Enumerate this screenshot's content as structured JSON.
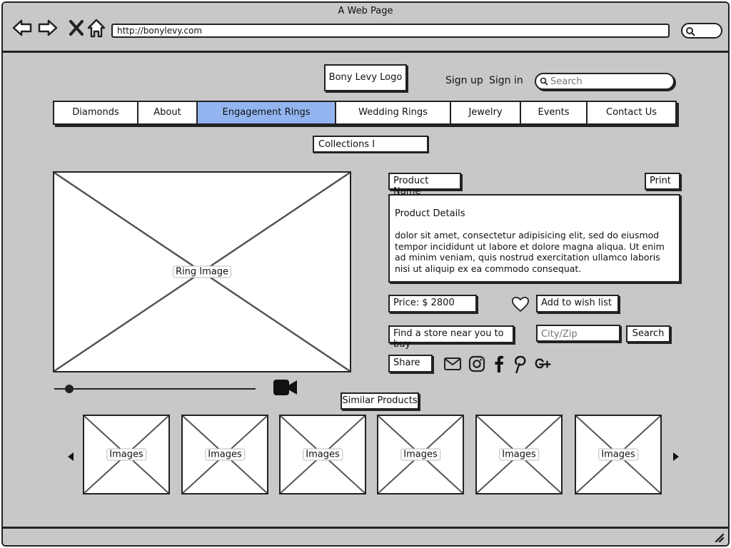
{
  "browser": {
    "window_title": "A Web Page",
    "url": "http://bonylevy.com"
  },
  "header": {
    "logo": "Bony Levy Logo",
    "sign_up": "Sign up",
    "sign_in": "Sign in",
    "search_placeholder": "Search"
  },
  "nav": {
    "items": [
      {
        "label": "Diamonds"
      },
      {
        "label": "About"
      },
      {
        "label": "Engagement Rings",
        "active": true
      },
      {
        "label": "Wedding Rings"
      },
      {
        "label": "Jewelry"
      },
      {
        "label": "Events"
      },
      {
        "label": "Contact Us"
      }
    ],
    "active_color": "#93b5ef"
  },
  "collections_dropdown": {
    "value": "Collections I"
  },
  "main_image": {
    "label": "Ring Image"
  },
  "product": {
    "name": "Product Name",
    "print": "Print",
    "details_title": "Product Details",
    "details_body": "dolor sit amet, consectetur adipisicing elit, sed do eiusmod tempor incididunt ut labore et dolore magna aliqua. Ut enim ad minim veniam, quis nostrud exercitation ullamco laboris nisi ut aliquip ex ea commodo consequat.",
    "price": "Price: $ 2800",
    "wish_list": "Add to wish list",
    "find_store": "Find a store near you to buy",
    "city_zip_placeholder": "City/Zip",
    "search_button": "Search",
    "share": "Share",
    "social_icons": [
      "mail-icon",
      "instagram-icon",
      "facebook-icon",
      "pinterest-icon",
      "google-plus-icon"
    ]
  },
  "media": {
    "video_icon": "video-camera-icon"
  },
  "similar": {
    "title": "Similar Products",
    "items": [
      {
        "label": "Images"
      },
      {
        "label": "Images"
      },
      {
        "label": "Images"
      },
      {
        "label": "Images"
      },
      {
        "label": "Images"
      },
      {
        "label": "Images"
      }
    ]
  }
}
